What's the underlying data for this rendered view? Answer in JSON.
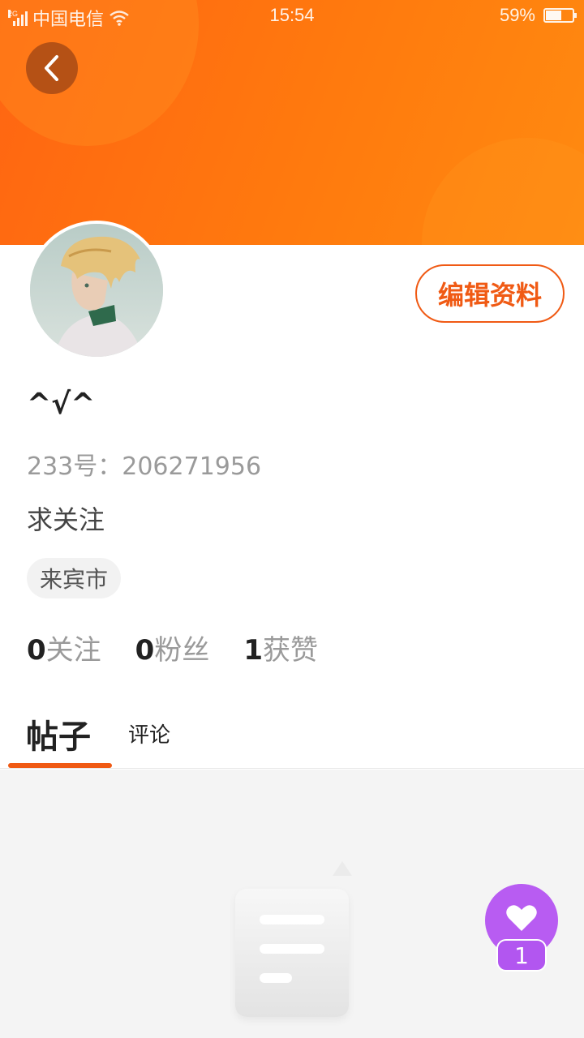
{
  "status_bar": {
    "network": "2G",
    "carrier": "中国电信",
    "time": "15:54",
    "battery": "59%",
    "battery_level": 0.59
  },
  "profile": {
    "username": "^√^",
    "id_text": "233号：206271956",
    "bio": "求关注",
    "location": "来宾市",
    "edit_label": "编辑资料"
  },
  "stats": [
    {
      "value": "0",
      "label": "关注"
    },
    {
      "value": "0",
      "label": "粉丝"
    },
    {
      "value": "1",
      "label": "获赞"
    }
  ],
  "tabs": {
    "posts": "帖子",
    "comments": "评论"
  },
  "like_fab": {
    "count": "1"
  },
  "colors": {
    "accent": "#f05a14",
    "header_start": "#ff6512",
    "header_end": "#ff8a10",
    "fab": "#b85cf2"
  },
  "icons": {
    "back": "chevron-left-icon",
    "like": "heart-icon",
    "empty": "document-icon"
  }
}
